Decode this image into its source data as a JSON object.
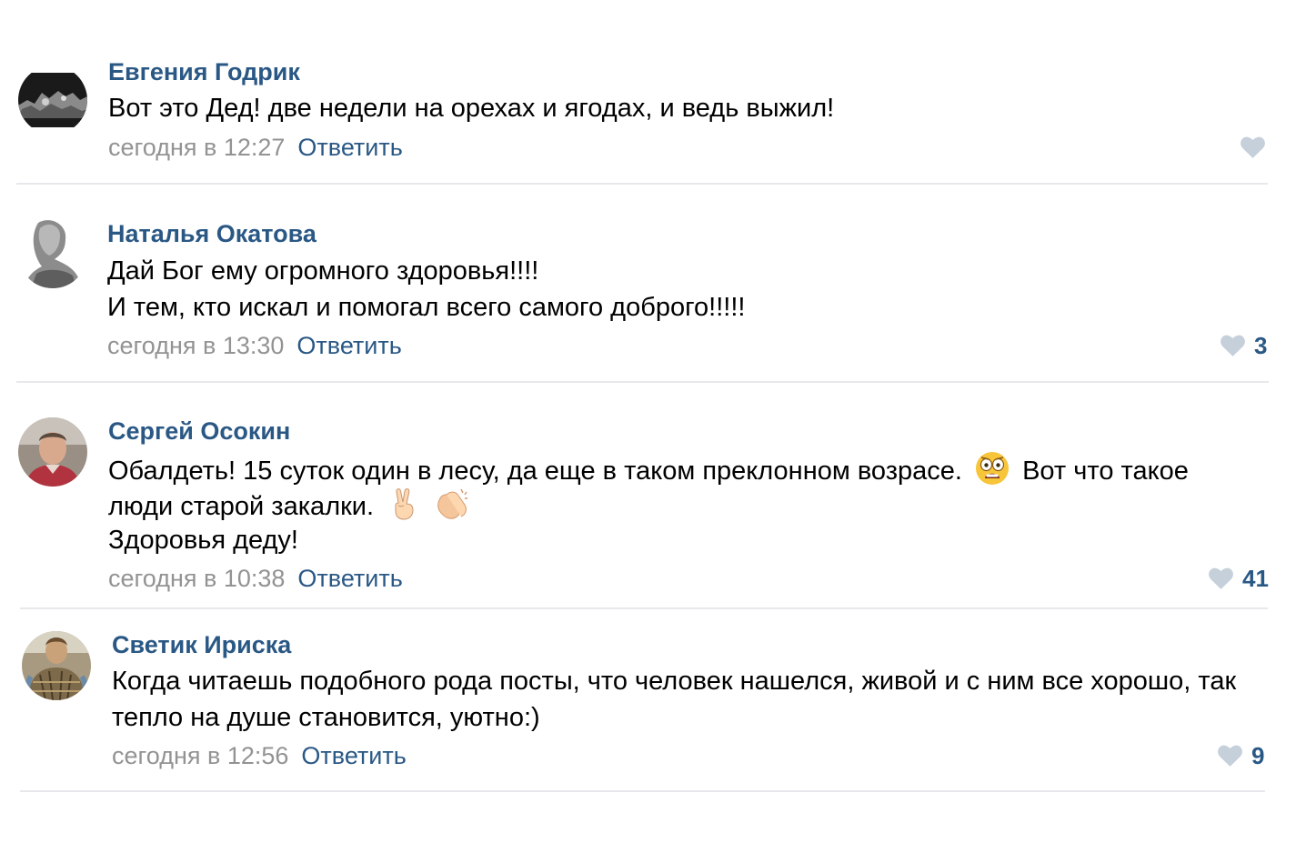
{
  "comments": [
    {
      "author": "Евгения Годрик",
      "lines": [
        "Вот это Дед! две недели на орехах и ягодах, и ведь выжил!"
      ],
      "date": "сегодня в 12:27",
      "reply_label": "Ответить",
      "likes": ""
    },
    {
      "author": "Наталья Окатова",
      "lines": [
        "Дай Бог ему огромного здоровья!!!!",
        "И тем, кто искал и помогал всего самого доброго!!!!!"
      ],
      "date": "сегодня в 13:30",
      "reply_label": "Ответить",
      "likes": "3"
    },
    {
      "author": "Сергей Осокин",
      "lines": [
        "Обалдеть! 15 суток один в лесу, да еще в таком преклонном возрасе.",
        "Вот что такое",
        "люди старой закалки.",
        "Здоровья деду!"
      ],
      "date": "сегодня в 10:38",
      "reply_label": "Ответить",
      "likes": "41"
    },
    {
      "author": "Светик Ириска",
      "lines": [
        "Когда читаешь подобного рода посты, что человек нашелся, живой и с ним все хорошо, так",
        "тепло на душе становится, уютно:)"
      ],
      "date": "сегодня в 12:56",
      "reply_label": "Ответить",
      "likes": "9"
    }
  ],
  "icons": {
    "like": "heart-icon",
    "emoji_scared": "astonished-face-icon",
    "emoji_victory": "victory-hand-icon",
    "emoji_clap": "clapping-hands-icon"
  },
  "colors": {
    "author": "#2a5885",
    "date": "#939393",
    "heart": "#c5d0db",
    "divider": "#e7e8ec"
  }
}
